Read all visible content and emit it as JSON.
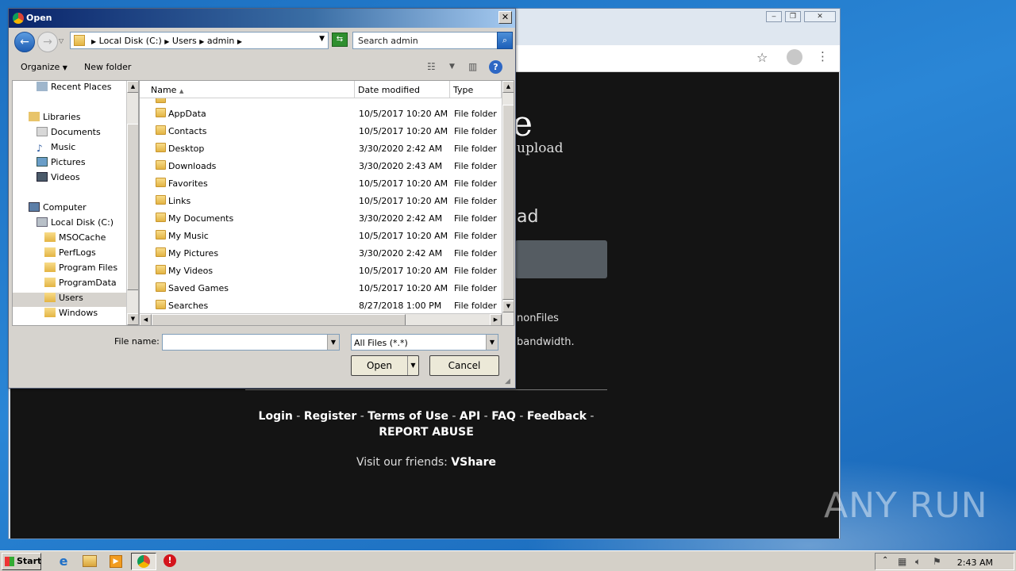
{
  "dialog": {
    "title": "Open",
    "nav": {
      "crumbs": [
        "Local Disk (C:)",
        "Users",
        "admin"
      ],
      "search_placeholder": "Search admin"
    },
    "toolbar": {
      "organize": "Organize",
      "new_folder": "New folder"
    },
    "sidebar": {
      "items": [
        {
          "label": "Recent Places",
          "icon": "recent-places-icon"
        },
        {
          "label": "Libraries",
          "icon": "libraries-icon"
        },
        {
          "label": "Documents",
          "icon": "documents-icon"
        },
        {
          "label": "Music",
          "icon": "music-icon"
        },
        {
          "label": "Pictures",
          "icon": "pictures-icon"
        },
        {
          "label": "Videos",
          "icon": "videos-icon"
        },
        {
          "label": "Computer",
          "icon": "computer-icon"
        },
        {
          "label": "Local Disk (C:)",
          "icon": "drive-icon"
        },
        {
          "label": "MSOCache",
          "icon": "folder-icon"
        },
        {
          "label": "PerfLogs",
          "icon": "folder-icon"
        },
        {
          "label": "Program Files",
          "icon": "folder-icon"
        },
        {
          "label": "ProgramData",
          "icon": "folder-icon"
        },
        {
          "label": "Users",
          "icon": "folder-icon",
          "selected": true
        },
        {
          "label": "Windows",
          "icon": "folder-icon"
        }
      ]
    },
    "columns": {
      "name": "Name",
      "date": "Date modified",
      "type": "Type"
    },
    "files": [
      {
        "name": "AppData",
        "date": "10/5/2017 10:20 AM",
        "type": "File folder"
      },
      {
        "name": "Contacts",
        "date": "10/5/2017 10:20 AM",
        "type": "File folder"
      },
      {
        "name": "Desktop",
        "date": "3/30/2020 2:42 AM",
        "type": "File folder"
      },
      {
        "name": "Downloads",
        "date": "3/30/2020 2:43 AM",
        "type": "File folder"
      },
      {
        "name": "Favorites",
        "date": "10/5/2017 10:20 AM",
        "type": "File folder"
      },
      {
        "name": "Links",
        "date": "10/5/2017 10:20 AM",
        "type": "File folder"
      },
      {
        "name": "My Documents",
        "date": "3/30/2020 2:42 AM",
        "type": "File folder"
      },
      {
        "name": "My Music",
        "date": "10/5/2017 10:20 AM",
        "type": "File folder"
      },
      {
        "name": "My Pictures",
        "date": "3/30/2020 2:42 AM",
        "type": "File folder"
      },
      {
        "name": "My Videos",
        "date": "10/5/2017 10:20 AM",
        "type": "File folder"
      },
      {
        "name": "Saved Games",
        "date": "10/5/2017 10:20 AM",
        "type": "File folder"
      },
      {
        "name": "Searches",
        "date": "8/27/2018 1:00 PM",
        "type": "File folder"
      }
    ],
    "file_name_label": "File name:",
    "file_name_value": "",
    "file_type": "All Files (*.*)",
    "open_label": "Open",
    "cancel_label": "Cancel"
  },
  "webpage": {
    "heading_fragment": "e",
    "upload_fragment": "upload",
    "ad_fragment": "ad",
    "anon_fragment": "nonFiles",
    "bandwidth_fragment": "bandwidth.",
    "footer_links": [
      "Login",
      "Register",
      "Terms of Use",
      "API",
      "FAQ",
      "Feedback",
      "REPORT ABUSE"
    ],
    "friends_text": "Visit our friends:",
    "friends_link": "VShare"
  },
  "watermark": "ANY RUN",
  "taskbar": {
    "start_label": "Start",
    "clock": "2:43 AM"
  }
}
